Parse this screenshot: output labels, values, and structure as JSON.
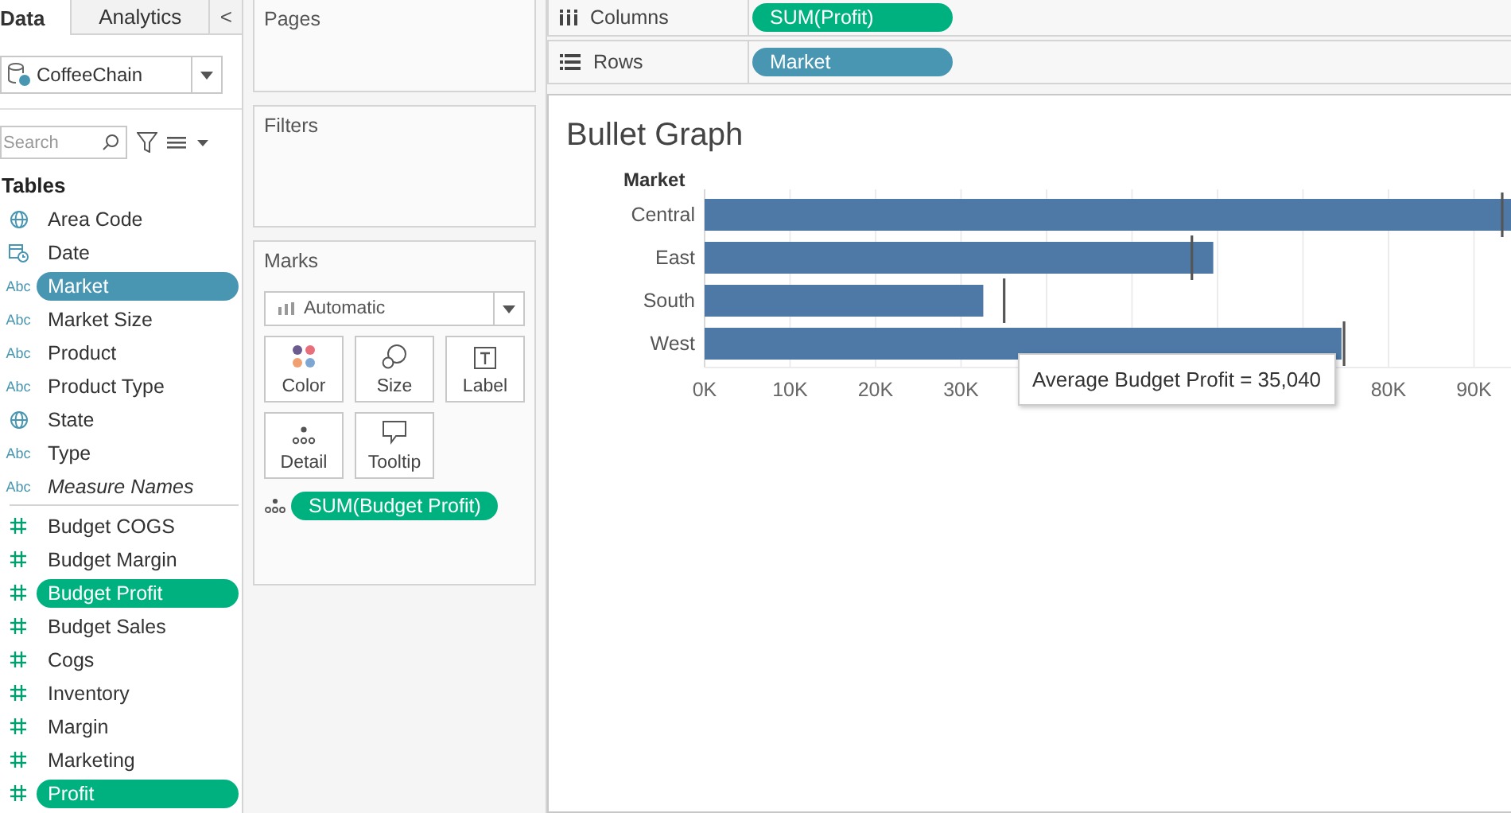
{
  "data_pane": {
    "tabs": [
      {
        "label": "Data",
        "selected": true
      },
      {
        "label": "Analytics",
        "selected": false
      }
    ],
    "collapse_glyph": "<",
    "datasource": "CoffeeChain",
    "search": {
      "placeholder": "Search"
    },
    "section_title": "Tables",
    "fields": [
      {
        "name": "Area Code",
        "kind": "geo",
        "selected": false
      },
      {
        "name": "Date",
        "kind": "date",
        "selected": false
      },
      {
        "name": "Market",
        "kind": "dimension",
        "type_label": "Abc",
        "selected": true
      },
      {
        "name": "Market Size",
        "kind": "dimension",
        "type_label": "Abc",
        "selected": false
      },
      {
        "name": "Product",
        "kind": "dimension",
        "type_label": "Abc",
        "selected": false
      },
      {
        "name": "Product Type",
        "kind": "dimension",
        "type_label": "Abc",
        "selected": false
      },
      {
        "name": "State",
        "kind": "geo",
        "selected": false
      },
      {
        "name": "Type",
        "kind": "dimension",
        "type_label": "Abc",
        "selected": false
      },
      {
        "name": "Measure Names",
        "kind": "dimension",
        "type_label": "Abc",
        "italic": true,
        "selected": false
      },
      {
        "name": "Budget COGS",
        "kind": "measure",
        "selected": false
      },
      {
        "name": "Budget Margin",
        "kind": "measure",
        "selected": false
      },
      {
        "name": "Budget Profit",
        "kind": "measure",
        "selected": true
      },
      {
        "name": "Budget Sales",
        "kind": "measure",
        "selected": false
      },
      {
        "name": "Cogs",
        "kind": "measure",
        "selected": false
      },
      {
        "name": "Inventory",
        "kind": "measure",
        "selected": false
      },
      {
        "name": "Margin",
        "kind": "measure",
        "selected": false
      },
      {
        "name": "Marketing",
        "kind": "measure",
        "selected": false
      },
      {
        "name": "Profit",
        "kind": "measure",
        "selected": true
      }
    ]
  },
  "cards": {
    "pages": "Pages",
    "filters": "Filters",
    "marks": {
      "title": "Marks",
      "mark_type": "Automatic",
      "buttons": [
        {
          "label": "Color",
          "kind": "color"
        },
        {
          "label": "Size",
          "kind": "size"
        },
        {
          "label": "Label",
          "kind": "label"
        },
        {
          "label": "Detail",
          "kind": "detail"
        },
        {
          "label": "Tooltip",
          "kind": "tooltip"
        }
      ],
      "pills": [
        {
          "label": "SUM(Budget Profit)",
          "kind": "measure"
        }
      ]
    }
  },
  "shelves": [
    {
      "title": "Columns",
      "kind": "columns",
      "pills": [
        {
          "label": "SUM(Profit)",
          "kind": "measure"
        }
      ]
    },
    {
      "title": "Rows",
      "kind": "rows",
      "pills": [
        {
          "label": "Market",
          "kind": "dimension"
        }
      ]
    }
  ],
  "view": {
    "title": "Bullet Graph",
    "chart_data": {
      "type": "bar",
      "orientation": "horizontal",
      "ylabel": "Market",
      "categories": [
        "Central",
        "East",
        "South",
        "West"
      ],
      "series": [
        {
          "color": "#4e79a7",
          "values": [
            94700,
            59500,
            32600,
            74500
          ]
        }
      ],
      "xticks": [
        {
          "value": 0,
          "label": "0K"
        },
        {
          "value": 10000,
          "label": "10K"
        },
        {
          "value": 20000,
          "label": "20K"
        },
        {
          "value": 30000,
          "label": "30K"
        },
        {
          "value": 80000,
          "label": "80K"
        },
        {
          "value": 90000,
          "label": "90K"
        }
      ],
      "xlim": [
        0,
        94700
      ],
      "grid": true,
      "ref_lines": [
        {
          "axis": "x",
          "value": 93300
        },
        {
          "axis": "x",
          "value": 57000
        },
        {
          "axis": "x",
          "value": 35040
        },
        {
          "axis": "x",
          "value": 74800
        }
      ]
    },
    "tooltip": "Average Budget Profit = 35,040"
  }
}
